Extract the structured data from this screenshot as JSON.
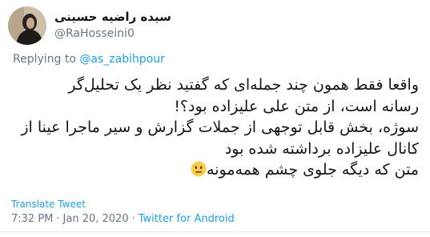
{
  "author": {
    "display_name": "سیده راضیه حسینی",
    "handle": "@RaHosseini0"
  },
  "reply": {
    "prefix": "Replying to",
    "mention": "@as_zabihpour"
  },
  "tweet": {
    "lines": [
      "واقعا فقط همون چند جمله‌ای که گفتید نظر  یک تحلیل‌گر",
      "رسانه است، از متن علی علیزاده بود؟!",
      "سوژه، بخش قابل توجهی از جملات گزارش و سیر ماجرا عینا از",
      "کانال علیزاده برداشته شده بود",
      "متن که دیگه جلوی چشم همه‌مونه"
    ],
    "emoji": "neutral-face-icon"
  },
  "translate_label": "Translate Tweet",
  "meta": {
    "time": "7:32 PM",
    "separator": "·",
    "date": "Jan 20, 2020",
    "source": "Twitter for Android"
  },
  "colors": {
    "link": "#1da1f2",
    "secondary_text": "#657786",
    "primary_text": "#14171a",
    "divider": "#e6ecf0"
  }
}
